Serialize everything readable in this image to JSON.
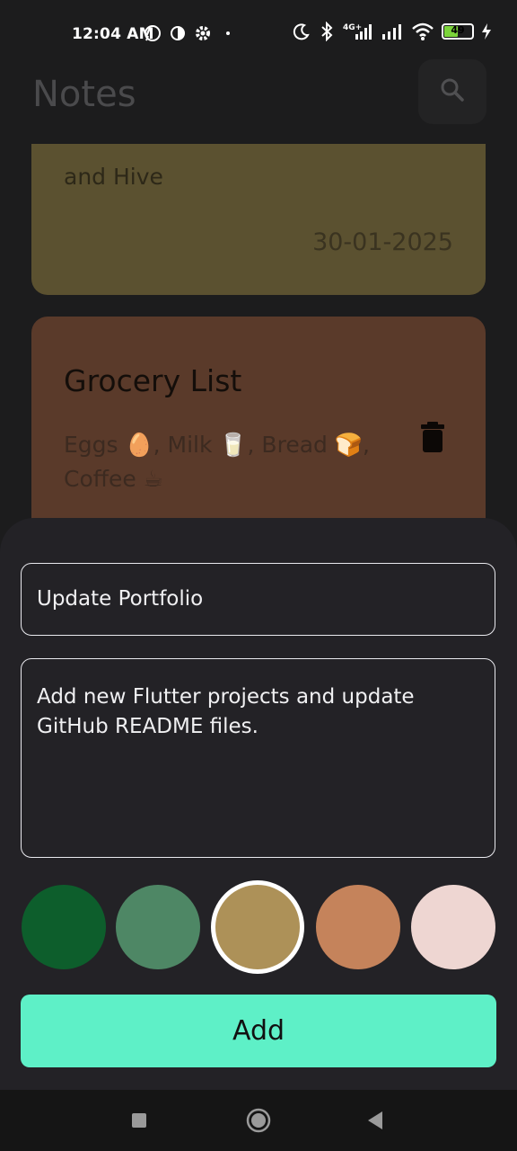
{
  "status_bar": {
    "time": "12:04 AM",
    "left_icons": [
      "whatsapp-icon",
      "app-circle-icon",
      "settings-gear-icon",
      "dot-icon"
    ],
    "right_icons": [
      "moon-icon",
      "bluetooth-icon",
      "signal-4g-icon",
      "signal-icon",
      "wifi-icon",
      "battery-icon",
      "charging-icon"
    ],
    "network_label": "4G+",
    "battery_level": "49",
    "battery_percent": 49
  },
  "header": {
    "title": "Notes",
    "search_icon": "search-icon"
  },
  "notes": [
    {
      "body_tail": "and Hive",
      "date": "30-01-2025",
      "color": "#5b5130"
    },
    {
      "title": "Grocery List",
      "body": "Eggs 🥚, Milk 🥛, Bread 🍞, Coffee ☕",
      "color": "#5a3a2a",
      "delete_icon": "trash-icon"
    }
  ],
  "sheet": {
    "title_value": "Update Portfolio",
    "content_value": "Add new Flutter projects and update GitHub README files.",
    "colors": [
      "#0d5e2c",
      "#4e8765",
      "#ad9158",
      "#c5835b",
      "#eed6d2"
    ],
    "selected_color_index": 2,
    "add_label": "Add"
  },
  "nav_bar": {
    "icons": [
      "square-recent-icon",
      "circle-home-icon",
      "triangle-back-icon"
    ]
  }
}
